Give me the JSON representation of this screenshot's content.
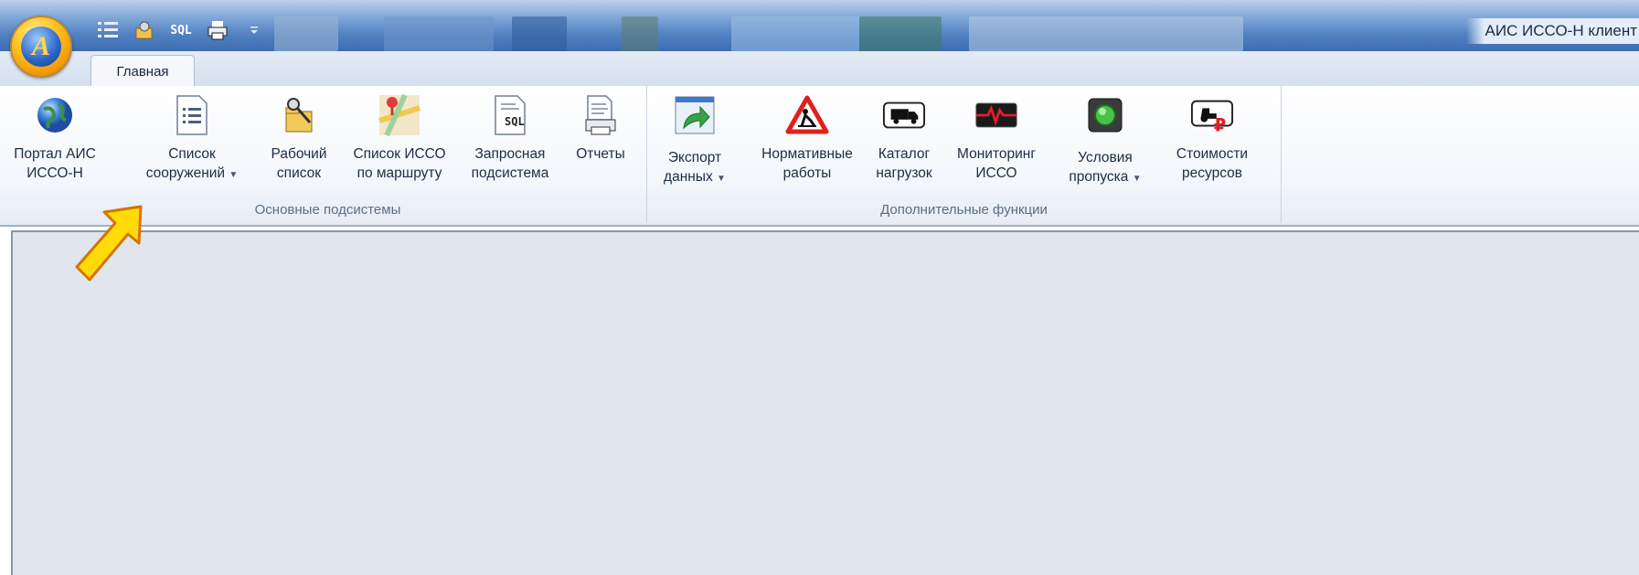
{
  "window": {
    "title": "АИС ИССО-Н клиент"
  },
  "app_button": {
    "letter": "A"
  },
  "quick_access": [
    {
      "name": "list-icon"
    },
    {
      "name": "worklist-icon"
    },
    {
      "name": "sql-icon",
      "text": "SQL"
    },
    {
      "name": "printer-icon"
    },
    {
      "name": "customize-dropdown-icon"
    }
  ],
  "tabs": [
    {
      "label": "Главная",
      "active": true
    }
  ],
  "groups": [
    {
      "label": "Основные подсистемы",
      "buttons": [
        {
          "line1": "Портал АИС",
          "line2": "ИССО-Н",
          "icon": "globe-icon",
          "dropdown": false
        },
        {
          "line1": "Список",
          "line2": "сооружений",
          "icon": "document-list-icon",
          "dropdown": true
        },
        {
          "line1": "Рабочий",
          "line2": "список",
          "icon": "tools-folder-icon",
          "dropdown": false
        },
        {
          "line1": "Список ИССО",
          "line2": "по маршруту",
          "icon": "map-pin-icon",
          "dropdown": false
        },
        {
          "line1": "Запросная",
          "line2": "подсистема",
          "icon": "sql-document-icon",
          "dropdown": false
        },
        {
          "line1": "Отчеты",
          "line2": "",
          "icon": "report-print-icon",
          "dropdown": false
        }
      ]
    },
    {
      "label": "Дополнительные функции",
      "buttons": [
        {
          "line1": "Экспорт",
          "line2": "данных",
          "icon": "export-arrow-icon",
          "dropdown": true
        },
        {
          "line1": "Нормативные",
          "line2": "работы",
          "icon": "road-works-sign-icon",
          "dropdown": false
        },
        {
          "line1": "Каталог",
          "line2": "нагрузок",
          "icon": "truck-icon",
          "dropdown": false
        },
        {
          "line1": "Мониторинг",
          "line2": "ИССО",
          "icon": "heartbeat-monitor-icon",
          "dropdown": false
        },
        {
          "line1": "Условия",
          "line2": "пропуска",
          "icon": "green-light-icon",
          "dropdown": true
        },
        {
          "line1": "Стоимости",
          "line2": "ресурсов",
          "icon": "tractor-ruble-icon",
          "dropdown": false
        }
      ]
    }
  ],
  "colors": {
    "accent_yellow": "#ffd400",
    "titlebar_blue": "#4f7fbf",
    "workspace": "#e1e6ee"
  }
}
